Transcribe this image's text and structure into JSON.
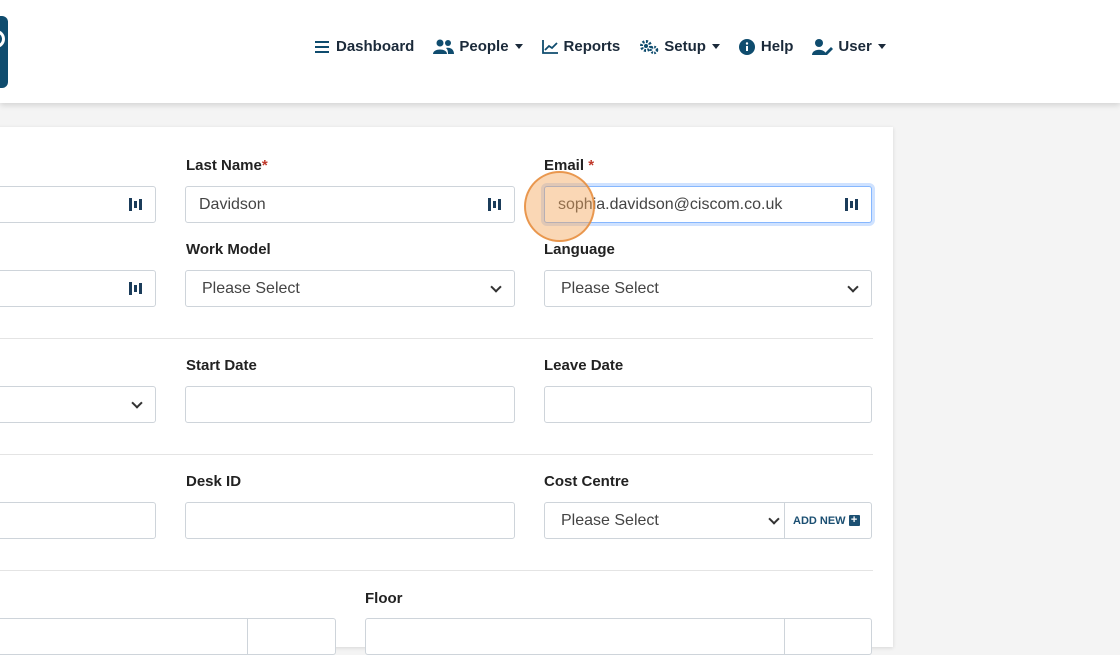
{
  "nav": {
    "dashboard": "Dashboard",
    "people": "People",
    "reports": "Reports",
    "setup": "Setup",
    "help": "Help",
    "user": "User"
  },
  "form": {
    "last_name": {
      "label": "Last Name",
      "required": "*",
      "value": "Davidson"
    },
    "email": {
      "label": "Email",
      "required": " *",
      "value": "sophia.davidson@ciscom.co.uk"
    },
    "work_model": {
      "label": "Work Model",
      "value": "Please Select"
    },
    "language": {
      "label": "Language",
      "value": "Please Select"
    },
    "start_date": {
      "label": "Start Date",
      "value": ""
    },
    "leave_date": {
      "label": "Leave Date",
      "value": ""
    },
    "desk_id": {
      "label": "Desk ID",
      "value": ""
    },
    "cost_centre": {
      "label": "Cost Centre",
      "value": "Please Select",
      "add_new": "ADD NEW"
    },
    "floor": {
      "label": "Floor"
    }
  },
  "colors": {
    "brand": "#0f4c6e",
    "required": "#c0392b",
    "click_marker": "#f5a65a"
  }
}
